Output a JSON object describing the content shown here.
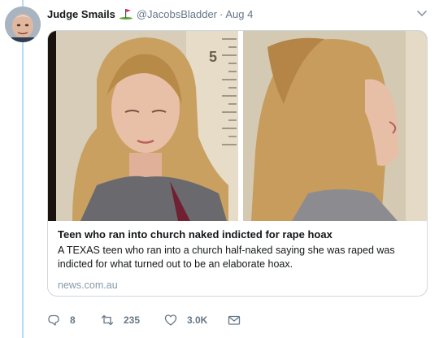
{
  "tweet": {
    "display_name": "Judge Smails",
    "name_emoji": "golf-flag-emoji",
    "handle": "@JacobsBladder",
    "separator": "·",
    "date": "Aug 4"
  },
  "card": {
    "title": "Teen who ran into church naked indicted for rape hoax",
    "description": "A TEXAS teen who ran into a church half-naked saying she was raped was indicted for what turned out to be an elaborate hoax.",
    "domain": "news.com.au",
    "image_marker": "5"
  },
  "actions": {
    "reply_count": "8",
    "retweet_count": "235",
    "like_count": "3.0K"
  },
  "colors": {
    "thread_line": "#b8dcf2",
    "secondary_text": "#657786",
    "domain_text": "#8899a6",
    "card_border": "#d0d8de"
  },
  "icons": [
    "chevron-down-icon",
    "reply-icon",
    "retweet-icon",
    "heart-icon",
    "message-icon"
  ]
}
